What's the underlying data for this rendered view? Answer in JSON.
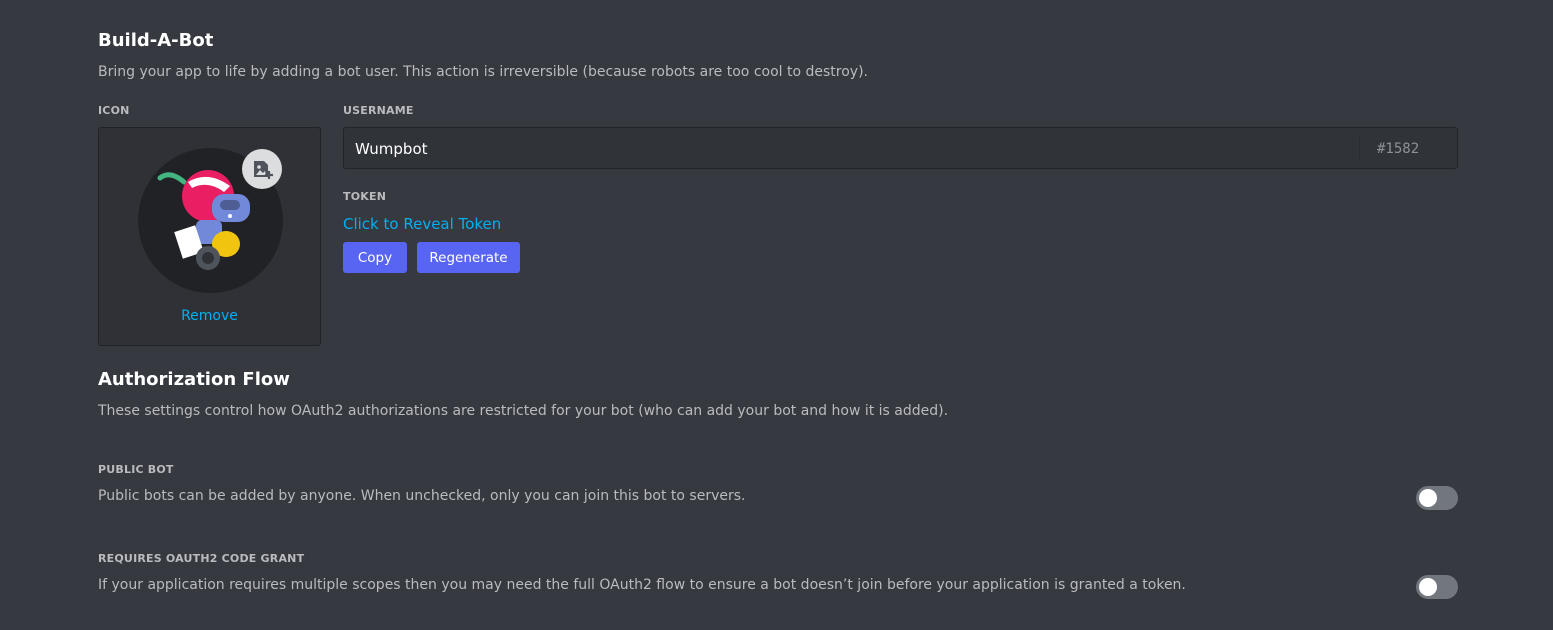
{
  "build_a_bot": {
    "title": "Build-A-Bot",
    "description": "Bring your app to life by adding a bot user. This action is irreversible (because robots are too cool to destroy).",
    "icon_label": "ICON",
    "remove_label": "Remove",
    "username_label": "USERNAME",
    "username_value": "Wumpbot",
    "discriminator": "#1582",
    "token_label": "TOKEN",
    "reveal_token_label": "Click to Reveal Token",
    "copy_label": "Copy",
    "regenerate_label": "Regenerate"
  },
  "authorization_flow": {
    "title": "Authorization Flow",
    "description": "These settings control how OAuth2 authorizations are restricted for your bot (who can add your bot and how it is added).",
    "settings": [
      {
        "label": "PUBLIC BOT",
        "description": "Public bots can be added by anyone. When unchecked, only you can join this bot to servers.",
        "enabled": false
      },
      {
        "label": "REQUIRES OAUTH2 CODE GRANT",
        "description": "If your application requires multiple scopes then you may need the full OAuth2 flow to ensure a bot doesn’t join before your application is granted a token.",
        "enabled": false
      }
    ]
  },
  "colors": {
    "background": "#36393f",
    "accent": "#5865f2",
    "link": "#00b0f4",
    "toggle_off": "#72767d"
  },
  "icons": [
    "image-upload-icon",
    "bot-avatar-icon"
  ]
}
